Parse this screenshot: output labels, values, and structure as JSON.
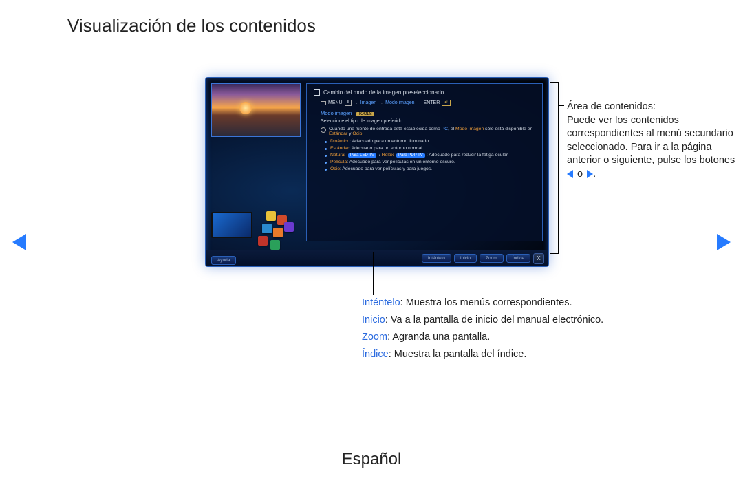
{
  "page": {
    "title": "Visualización de los contenidos",
    "language": "Español"
  },
  "tv": {
    "content_title": "Cambio del modo de la imagen preseleccionado",
    "breadcrumb": {
      "menu": "MENU",
      "step1": "Imagen",
      "step2": "Modo imagen",
      "enter": "ENTER"
    },
    "section_label": "Modo imagen",
    "tools_label": "TOOLS",
    "desc": "Seleccione el tipo de imagen preferido.",
    "note": {
      "prefix": "Cuando una fuente de entrada está establecida como ",
      "pc": "PC",
      "mid": ", el ",
      "modo_imagen": "Modo imagen",
      "mid2": " sólo está disponible en ",
      "estandar": "Estándar",
      "and": " y ",
      "ocio": "Ocio",
      "end": "."
    },
    "modes": [
      {
        "name": "Dinámico",
        "desc": ": Adecuado para un entorno iluminado."
      },
      {
        "name": "Estándar",
        "desc": ": Adecuado para un entorno normal."
      },
      {
        "name": "Natural",
        "chip1": "Para LED TV",
        "slash": " / ",
        "alt": "Relax",
        "chip2": "Para PDP TV",
        "desc": ": Adecuado para reducir la fatiga ocular."
      },
      {
        "name": "Película",
        "desc": ": Adecuado para ver películas en un entorno oscuro."
      },
      {
        "name": "Ocio",
        "desc": ": Adecuado para ver películas y para juegos."
      }
    ],
    "bar": {
      "left": "Ayuda",
      "buttons": [
        "Inténtelo",
        "Inicio",
        "Zoom",
        "Índice"
      ],
      "close": "X"
    }
  },
  "side_callout": {
    "line1": "Área de contenidos:",
    "body": "Puede ver los contenidos correspondientes al menú secundario seleccionado. Para ir a la página anterior o siguiente, pulse los botones",
    "or": " o "
  },
  "bottom_callouts": [
    {
      "key": "Inténtelo",
      "text": ": Muestra los menús correspondientes."
    },
    {
      "key": "Inicio",
      "text": ": Va a la pantalla de inicio del manual electrónico."
    },
    {
      "key": "Zoom",
      "text": ": Agranda una pantalla."
    },
    {
      "key": "Índice",
      "text": ": Muestra la pantalla del índice."
    }
  ]
}
